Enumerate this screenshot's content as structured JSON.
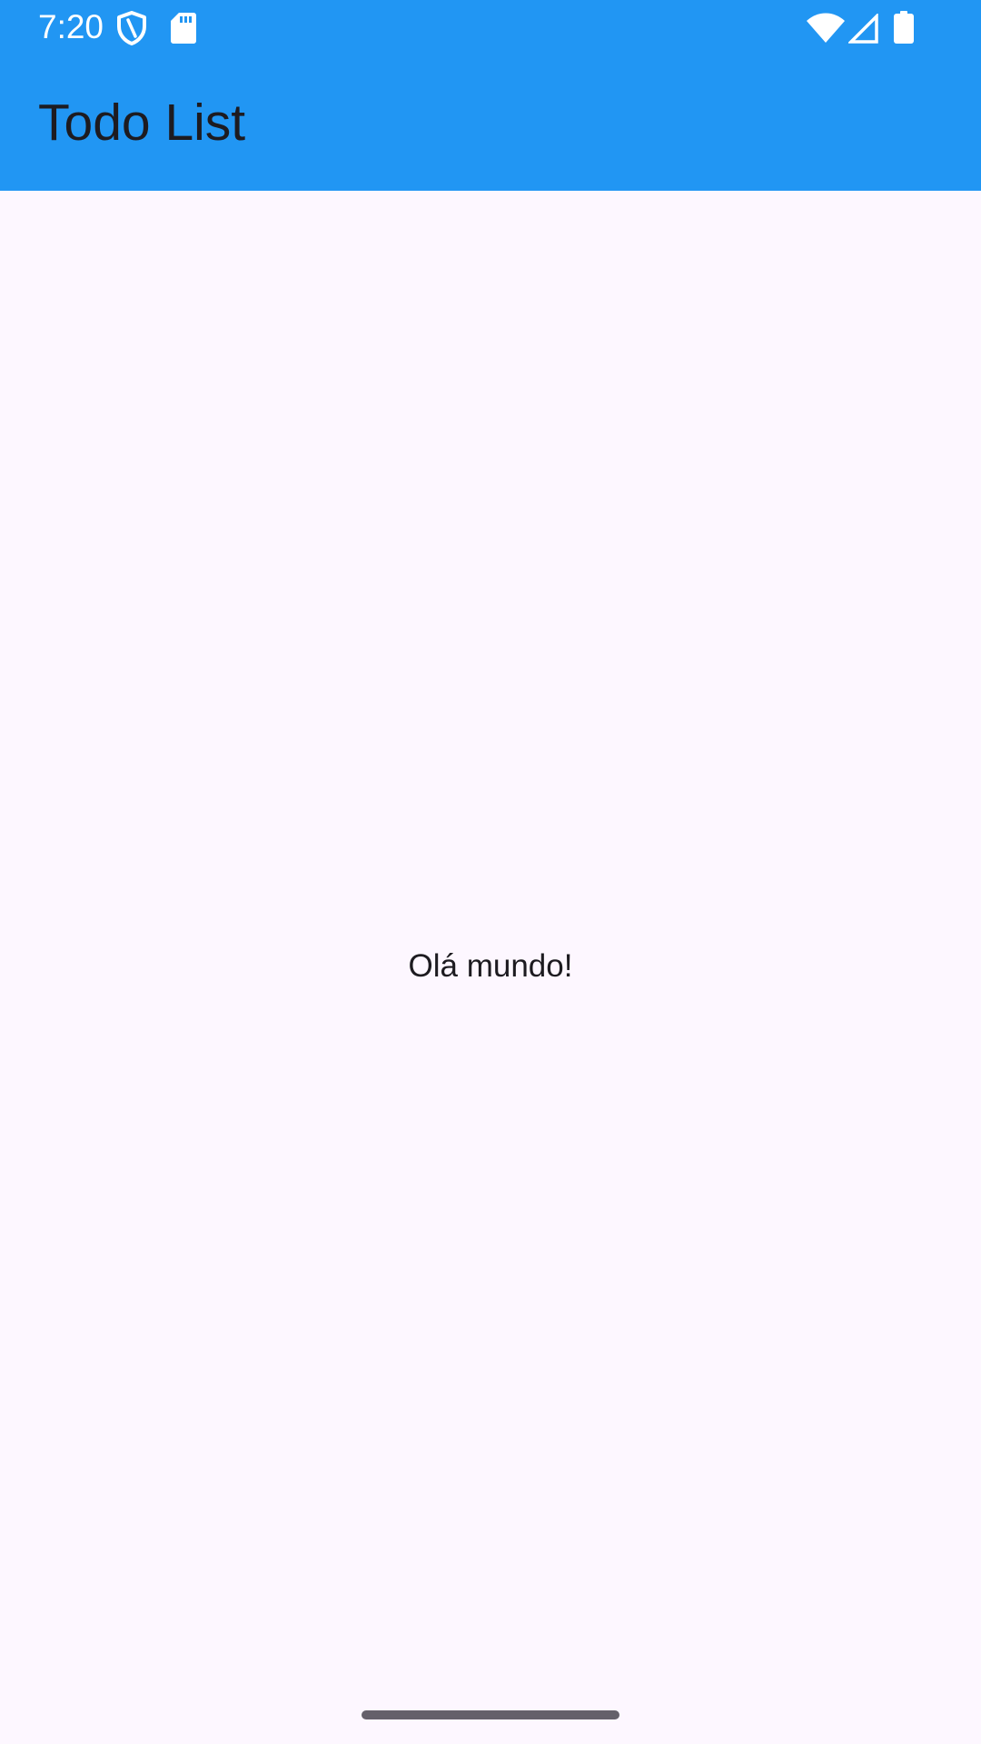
{
  "status_bar": {
    "time": "7:20",
    "icons": [
      "shield-icon",
      "sd-card-icon",
      "wifi-icon",
      "cell-signal-icon",
      "battery-icon"
    ]
  },
  "app_bar": {
    "title": "Todo List"
  },
  "main": {
    "message": "Olá mundo!"
  },
  "colors": {
    "app_bar": "#2196f3",
    "background": "#fdf7ff",
    "text": "#1d1b20",
    "status_icons": "#ffffff",
    "home_indicator": "#65606a"
  }
}
